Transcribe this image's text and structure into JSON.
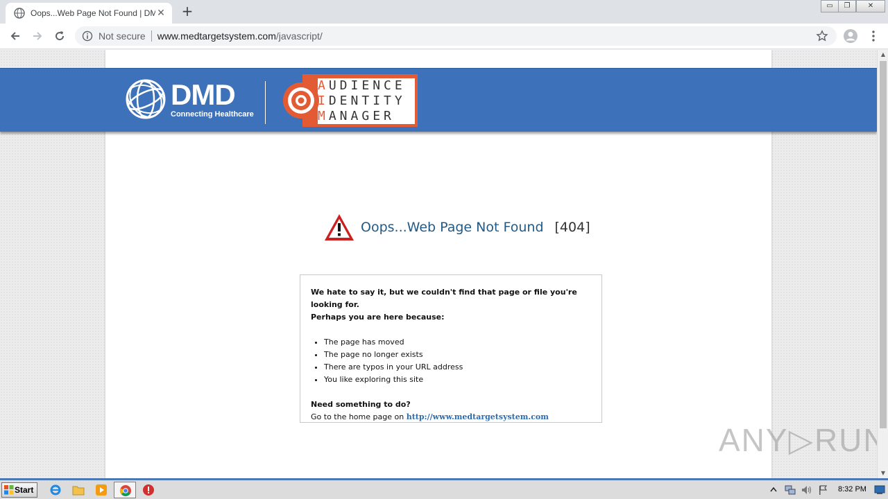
{
  "browser": {
    "tab_title": "Oops...Web Page Not Found | DMD",
    "tab_close": "✕",
    "new_tab": "+",
    "security_label": "Not secure",
    "url_host": "www.medtargetsystem.com",
    "url_path": "/javascript/"
  },
  "window_controls": {
    "minimize": "▭",
    "restore": "❐",
    "close": "✕"
  },
  "banner": {
    "dmd_name": "DMD",
    "dmd_tagline": "Connecting Healthcare",
    "aim_lines": [
      {
        "first": "A",
        "rest": "UDIENCE"
      },
      {
        "first": "I",
        "rest": "DENTITY"
      },
      {
        "first": "M",
        "rest": "ANAGER"
      }
    ]
  },
  "error": {
    "title": "Oops...Web Page Not Found",
    "code": "[404]"
  },
  "message": {
    "intro_line1": "We hate to say it, but we couldn't find that page or file you're looking for.",
    "intro_line2": "Perhaps you are here because:",
    "reasons": [
      "The page has moved",
      "The page no longer exists",
      "There are typos in your URL address",
      "You like exploring this site"
    ],
    "help_heading": "Need something to do?",
    "home_prefix": "Go to the home page on",
    "home_link": "http://www.medtargetsystem.com"
  },
  "watermark": "ANY▷RUN",
  "taskbar": {
    "start_label": "Start",
    "clock": "8:32 PM"
  },
  "colors": {
    "banner_blue": "#3d72bb",
    "aim_orange": "#e35b35",
    "title_blue": "#215a87",
    "link_blue": "#2b6cb0"
  }
}
